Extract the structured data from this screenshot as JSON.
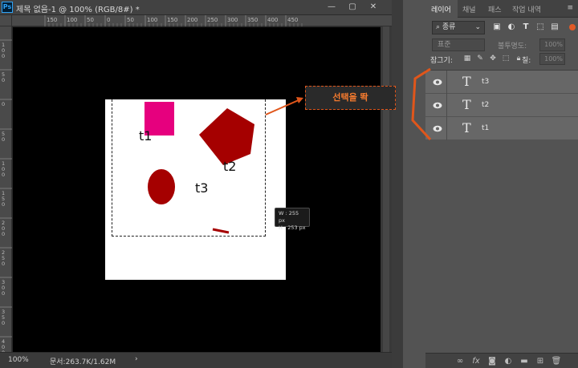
{
  "document": {
    "title": "제목 없음-1 @ 100% (RGB/8#) *",
    "app_icon": "Ps",
    "ruler_top_labels": [
      "150",
      "100",
      "50",
      "0",
      "50",
      "100",
      "150",
      "200",
      "250",
      "300",
      "350",
      "400",
      "450"
    ],
    "ruler_left_labels": [
      "1 0 0",
      "5 0",
      "0",
      "5 0",
      "1 0 0",
      "1 5 0",
      "2 0 0",
      "2 5 0",
      "3 0 0",
      "3 5 0",
      "4 0 0"
    ],
    "canvas_layers": [
      {
        "label": "t1"
      },
      {
        "label": "t2"
      },
      {
        "label": "t3"
      }
    ],
    "dimension_tooltip": {
      "w": "W : 255 px",
      "h": "H : 253 px"
    },
    "callout_text": "선택을 똭",
    "status": {
      "zoom": "100%",
      "doc_size": "문서:263.7K/1.62M",
      "arrow": "›"
    }
  },
  "panel": {
    "tabs": [
      "레이어",
      "채널",
      "패스",
      "작업 내역"
    ],
    "active_tab": "레이어",
    "filter": {
      "select": "⌕ 종류",
      "icons": [
        "image-filter-icon",
        "adjustment-filter-icon",
        "type-filter-icon",
        "shape-filter-icon",
        "smart-object-filter-icon"
      ]
    },
    "blend_mode": "표준",
    "opacity_label": "불투명도:",
    "opacity_value": "100%",
    "lock_label": "잠그기:",
    "fill_label": "칠:",
    "fill_value": "100%",
    "layers": [
      {
        "thumb": "T",
        "name": "t3"
      },
      {
        "thumb": "T",
        "name": "t2"
      },
      {
        "thumb": "T",
        "name": "t1"
      }
    ]
  },
  "colors": {
    "accent_orange": "#e0561b",
    "magenta": "#e6007e",
    "dark_red": "#a50000"
  }
}
